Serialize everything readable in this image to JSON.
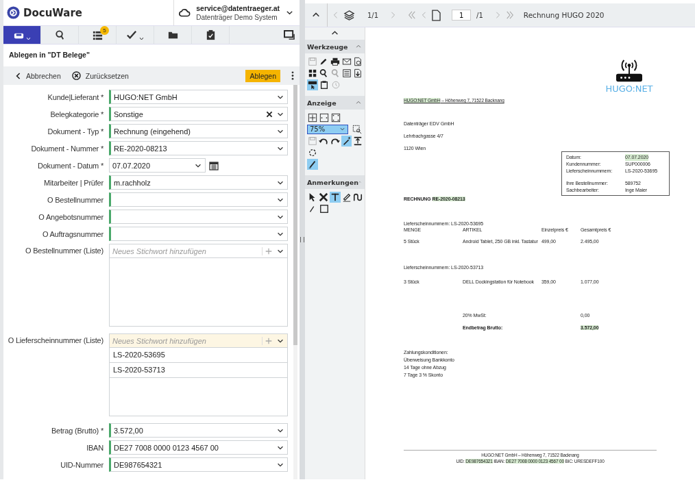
{
  "app": {
    "brand": "DocuWare"
  },
  "account": {
    "email": "service@datentraeger.at",
    "system": "Datenträger Demo System"
  },
  "nav_tabs": [
    {
      "selected": true,
      "caret": true
    },
    {
      "selected": false,
      "caret": false
    },
    {
      "selected": false,
      "caret": false,
      "badge": "5"
    },
    {
      "selected": false,
      "caret": true
    },
    {
      "selected": false,
      "caret": false
    },
    {
      "selected": false,
      "caret": false
    }
  ],
  "form": {
    "title": "Ablegen in \"DT Belege\"",
    "cancel": "Abbrechen",
    "reset": "Zurücksetzen",
    "submit": "Ablegen",
    "fields": [
      {
        "kind": "select",
        "label": "Kunde|Lieferant *",
        "value": "HUGO:NET GmbH",
        "indexed": true
      },
      {
        "kind": "clearable",
        "label": "Belegkategorie *",
        "value": "Sonstige",
        "indexed": true
      },
      {
        "kind": "select",
        "label": "Dokument - Typ *",
        "value": "Rechnung (eingehend)",
        "indexed": true
      },
      {
        "kind": "select",
        "label": "Dokument - Nummer *",
        "value": "RE-2020-08213",
        "indexed": true
      },
      {
        "kind": "date",
        "label": "Dokument - Datum *",
        "value": "07.07.2020",
        "indexed": false
      },
      {
        "kind": "select",
        "label": "Mitarbeiter | Prüfer",
        "value": "m.rachholz",
        "indexed": true
      },
      {
        "kind": "select",
        "label": "O Bestellnummer",
        "indexed": true
      },
      {
        "kind": "select",
        "label": "O Angebotsnummer",
        "indexed": true
      },
      {
        "kind": "select",
        "label": "O Auftragsnummer",
        "indexed": true
      },
      {
        "kind": "keywords",
        "label": "O Bestellnummer (Liste)",
        "placeholder": "Neues Stichwort hinzufügen",
        "focused": false,
        "indexed": false
      },
      {
        "kind": "keywords",
        "label": "O Lieferscheinnummer (Liste)",
        "placeholder": "Neues Stichwort hinzufügen",
        "focused": true,
        "indexed": false,
        "entries": [
          "LS-2020-53695",
          "LS-2020-53713"
        ]
      },
      {
        "kind": "select",
        "label": "Betrag (Brutto) *",
        "value": "3.572,00",
        "indexed": true
      },
      {
        "kind": "select",
        "label": "IBAN",
        "value": "DE27 7008 0000 0123 4567 00",
        "indexed": true
      },
      {
        "kind": "select",
        "label": "UID-Nummer",
        "value": "DE987654321",
        "indexed": true
      }
    ]
  },
  "viewer": {
    "layers": "1/1",
    "page": "1",
    "page_total": "/1",
    "title": "Rechnung HUGO 2020"
  },
  "tool_sections": [
    {
      "title": "Werkzeuge",
      "rows": [
        [
          {
            "kind": "icon",
            "on": false,
            "disabled": true
          },
          {
            "kind": "icon",
            "on": false,
            "disabled": false
          },
          {
            "kind": "icon",
            "on": false,
            "disabled": false
          },
          {
            "kind": "icon",
            "on": false,
            "disabled": false
          },
          {
            "kind": "icon",
            "on": false,
            "disabled": false
          }
        ],
        [
          {
            "kind": "icon",
            "on": false,
            "disabled": false
          },
          {
            "kind": "icon",
            "on": false,
            "disabled": false
          },
          {
            "kind": "icon",
            "on": false,
            "disabled": true
          },
          {
            "kind": "icon",
            "on": false,
            "disabled": false
          },
          {
            "kind": "icon",
            "on": false,
            "disabled": false
          }
        ],
        [
          {
            "kind": "icon",
            "on": true,
            "disabled": false
          },
          {
            "kind": "icon",
            "on": false,
            "disabled": false
          },
          {
            "kind": "icon",
            "on": false,
            "disabled": true
          }
        ]
      ]
    },
    {
      "title": "Anzeige",
      "rows": [
        [
          {
            "kind": "icon",
            "on": false,
            "disabled": false
          },
          {
            "kind": "icon",
            "on": false,
            "disabled": false
          },
          {
            "kind": "icon",
            "on": false,
            "disabled": false
          }
        ],
        [
          {
            "kind": "zoom",
            "value": "75%"
          },
          {
            "kind": "icon",
            "on": false,
            "disabled": false
          }
        ],
        [
          {
            "kind": "icon",
            "on": false,
            "disabled": true
          },
          {
            "kind": "icon",
            "on": false,
            "disabled": false
          },
          {
            "kind": "icon",
            "on": false,
            "disabled": false
          },
          {
            "kind": "icon",
            "on": true,
            "disabled": false
          },
          {
            "kind": "icon",
            "on": false,
            "disabled": false
          }
        ],
        [
          {
            "kind": "icon",
            "on": false,
            "disabled": false
          }
        ],
        [
          {
            "kind": "icon",
            "on": true,
            "disabled": false
          }
        ]
      ]
    },
    {
      "title": "Anmerkungen",
      "rows": [
        [
          {
            "kind": "icon",
            "on": false,
            "disabled": false
          },
          {
            "kind": "icon",
            "on": false,
            "disabled": false
          },
          {
            "kind": "icon",
            "on": true,
            "disabled": false
          },
          {
            "kind": "icon",
            "on": false,
            "disabled": false
          },
          {
            "kind": "icon",
            "on": false,
            "disabled": false
          }
        ],
        [
          {
            "kind": "icon",
            "on": false,
            "disabled": false
          },
          {
            "kind": "icon",
            "on": false,
            "disabled": false
          }
        ]
      ]
    }
  ],
  "document": {
    "logo": "HUGO:NET",
    "sender": [
      {
        "text": "HUGO:NET GmbH",
        "highlight": true
      },
      {
        "text": " – Höhenweg 7, 71522 Backnang",
        "highlight": false
      }
    ],
    "recipient": [
      "Datenträger EDV GmbH",
      "Lehrbachgasse 4/7",
      "1120 Wien"
    ],
    "info_groups": [
      [
        {
          "label": "Datum:",
          "value": "07.07.2020",
          "highlight": true
        },
        {
          "label": "Kundennummer:",
          "value": "SUP000006",
          "highlight": false
        },
        {
          "label": "Lieferscheinnummern:",
          "value": "LS-2020-53695",
          "highlight": false
        }
      ],
      [
        {
          "label": "Ihre Bestellnummer:",
          "value": "589752",
          "highlight": false
        },
        {
          "label": "Sachbearbeiter:",
          "value": "Inge Maier",
          "highlight": false
        }
      ]
    ],
    "heading": [
      {
        "text": "RECHNUNG ",
        "highlight": false
      },
      {
        "text": "RE-2020-08213",
        "highlight": true
      }
    ],
    "groups": [
      {
        "delivery": "Lieferscheinnummern: LS-2020-53695",
        "header": [
          "MENGE",
          "ARTIKEL",
          "Einzelpreis €",
          "Gesamtpreis €"
        ],
        "rows": [
          [
            "5 Stück",
            "Android Tablet, 250 GB inkl. Tastatur",
            "499,00",
            "2.495,00"
          ]
        ]
      },
      {
        "delivery": "Lieferscheinnummern: LS-2020-53713",
        "rows": [
          [
            "3 Stück",
            "DELL Dockingstation für Notebook",
            "359,00",
            "1.077,00"
          ]
        ]
      }
    ],
    "totals": [
      {
        "label": "20% MwSt:",
        "value": "0,00",
        "bold": false,
        "highlight": false
      },
      {
        "label": "Endbetrag Brutto:",
        "value": "3.572,00",
        "bold": true,
        "highlight": true
      }
    ],
    "terms": [
      "Zahlungskonditionen:",
      "Überweisung Bankkonto",
      "14 Tage ohne Abzug",
      "7 Tage 3 % Skonto"
    ],
    "footer": [
      [
        {
          "text": "HUGO:NET GmbH – Höhenweg 7, 71522 Backnang",
          "highlight": false
        }
      ],
      [
        {
          "text": "UID: ",
          "highlight": false
        },
        {
          "text": "DE987654321",
          "highlight": true
        },
        {
          "text": " IBAN: ",
          "highlight": false
        },
        {
          "text": "DE27 7008 0000 0123 4567 00",
          "highlight": true
        },
        {
          "text": " BIC: URESDEFF100",
          "highlight": false
        }
      ]
    ]
  }
}
